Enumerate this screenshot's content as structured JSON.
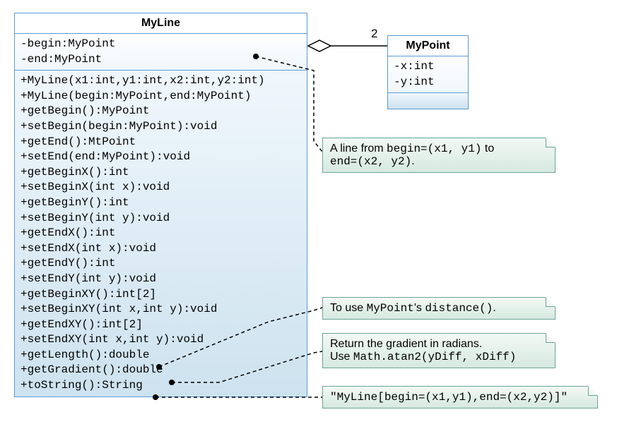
{
  "myline": {
    "title": "MyLine",
    "attributes": [
      "-begin:MyPoint",
      "-end:MyPoint"
    ],
    "methods": [
      "+MyLine(x1:int,y1:int,x2:int,y2:int)",
      "+MyLine(begin:MyPoint,end:MyPoint)",
      "+getBegin():MyPoint",
      "+setBegin(begin:MyPoint):void",
      "+getEnd():MtPoint",
      "+setEnd(end:MyPoint):void",
      "+getBeginX():int",
      "+setBeginX(int x):void",
      "+getBeginY():int",
      "+setBeginY(int y):void",
      "+getEndX():int",
      "+setEndX(int x):void",
      "+getEndY():int",
      "+setEndY(int y):void",
      "+getBeginXY():int[2]",
      "+setBeginXY(int x,int y):void",
      "+getEndXY():int[2]",
      "+setEndXY(int x,int y):void",
      "+getLength():double",
      "+getGradient():double",
      "+toString():String"
    ]
  },
  "mypoint": {
    "title": "MyPoint",
    "attributes": [
      "-x:int",
      "-y:int"
    ]
  },
  "multiplicity": "2",
  "notes": {
    "n1": {
      "text_a": "A line from ",
      "text_b": "begin=(x1, y1)",
      "text_c": " to",
      "text_d": "end=(x2, y2)",
      "text_e": "."
    },
    "n2": {
      "text_a": "To use ",
      "text_b": "MyPoint",
      "text_c": "'s ",
      "text_d": "distance()",
      "text_e": "."
    },
    "n3": {
      "line1": "Return the gradient in radians.",
      "line2_a": "Use ",
      "line2_b": "Math.atan2(yDiff, xDiff)"
    },
    "n4": {
      "text": "\"MyLine[begin=(x1,y1),end=(x2,y2)]\""
    }
  }
}
